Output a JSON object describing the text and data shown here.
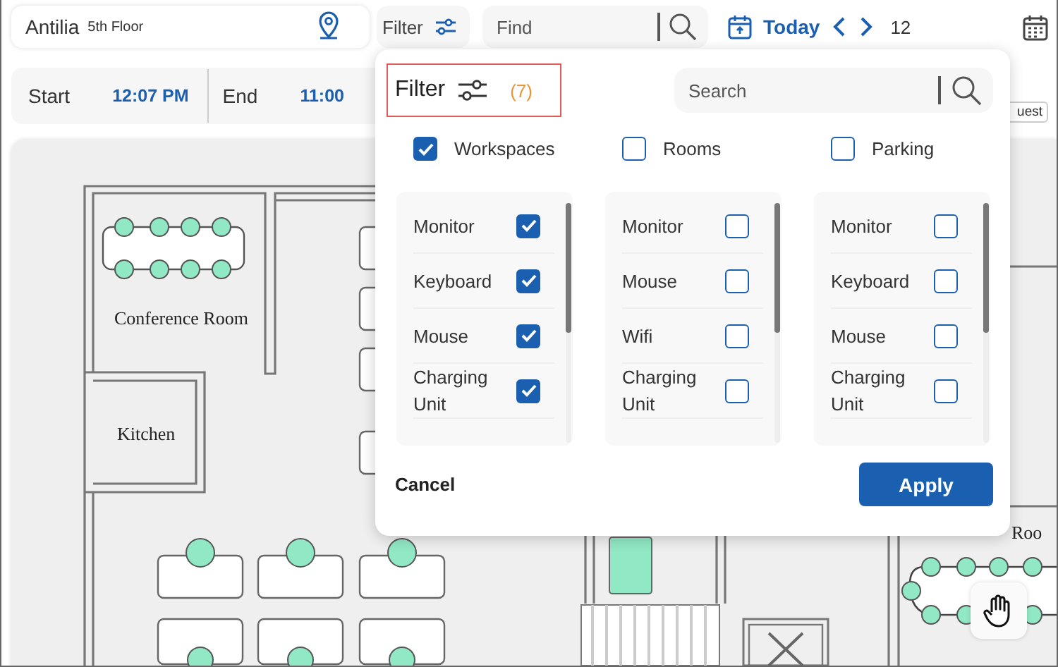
{
  "location": {
    "building": "Antilia",
    "floor": "5th Floor"
  },
  "toolbar": {
    "filter_label": "Filter",
    "find": {
      "placeholder": "Find"
    },
    "today_label": "Today",
    "date": "12"
  },
  "time_range": {
    "start_label": "Start",
    "start": "12:07 PM",
    "end_label": "End",
    "end": "11:00"
  },
  "guest_badge": "uest",
  "floor_plan": {
    "room_labels": [
      "Conference Room",
      "Kitchen",
      "Roo"
    ]
  },
  "filter": {
    "title": "Filter",
    "count": "(7)",
    "search": {
      "placeholder": "Search"
    },
    "categories": [
      {
        "label": "Workspaces",
        "checked": true,
        "options": [
          {
            "label": "Monitor",
            "checked": true
          },
          {
            "label": "Keyboard",
            "checked": true
          },
          {
            "label": "Mouse",
            "checked": true
          },
          {
            "label": "Charging Unit",
            "checked": true
          }
        ]
      },
      {
        "label": "Rooms",
        "checked": false,
        "options": [
          {
            "label": "Monitor",
            "checked": false
          },
          {
            "label": "Mouse",
            "checked": false
          },
          {
            "label": "Wifi",
            "checked": false
          },
          {
            "label": "Charging Unit",
            "checked": false
          }
        ]
      },
      {
        "label": "Parking",
        "checked": false,
        "options": [
          {
            "label": "Monitor",
            "checked": false
          },
          {
            "label": "Keyboard",
            "checked": false
          },
          {
            "label": "Mouse",
            "checked": false
          },
          {
            "label": "Charging Unit",
            "checked": false
          }
        ]
      }
    ],
    "cancel": "Cancel",
    "apply": "Apply"
  }
}
